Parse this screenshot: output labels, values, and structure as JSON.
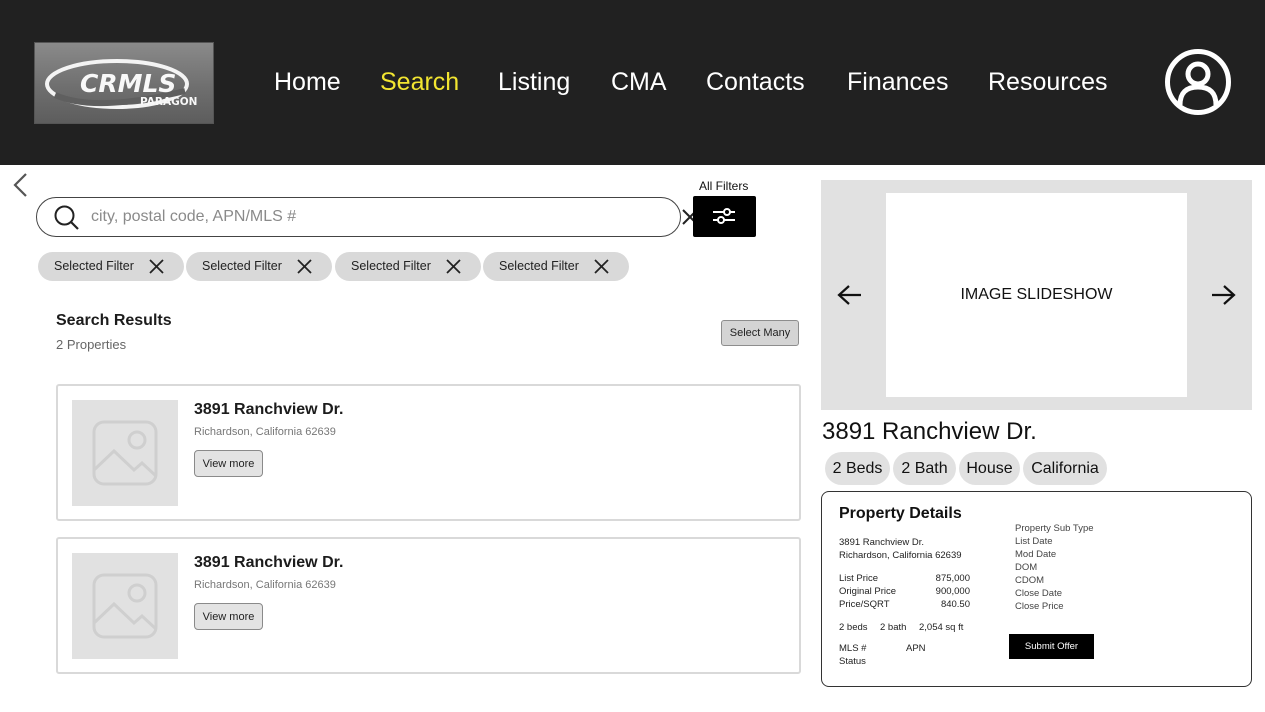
{
  "header": {
    "logo": {
      "text": "CRMLS",
      "subtext": "PARAGON"
    },
    "nav": [
      {
        "label": "Home",
        "active": false
      },
      {
        "label": "Search",
        "active": true
      },
      {
        "label": "Listing",
        "active": false
      },
      {
        "label": "CMA",
        "active": false
      },
      {
        "label": "Contacts",
        "active": false
      },
      {
        "label": "Finances",
        "active": false
      },
      {
        "label": "Resources",
        "active": false
      }
    ],
    "profile_icon": "user-circle-icon"
  },
  "search": {
    "placeholder": "city, postal code, APN/MLS #",
    "value": "",
    "all_filters_label": "All Filters"
  },
  "filters": [
    {
      "label": "Selected Filter"
    },
    {
      "label": "Selected Filter"
    },
    {
      "label": "Selected Filter"
    },
    {
      "label": "Selected Filter"
    }
  ],
  "results": {
    "title": "Search Results",
    "count": "2 Properties",
    "select_many_label": "Select Many",
    "items": [
      {
        "address": "3891 Ranchview Dr.",
        "city": "Richardson, California 62639",
        "button": "View more"
      },
      {
        "address": "3891 Ranchview Dr.",
        "city": "Richardson, California 62639",
        "button": "View more"
      }
    ]
  },
  "slideshow": {
    "label": "IMAGE SLIDESHOW"
  },
  "detail": {
    "title": "3891 Ranchview Dr.",
    "tags": [
      "2 Beds",
      "2 Bath",
      "House",
      "California"
    ],
    "card": {
      "title": "Property Details",
      "address_line1": "3891 Ranchview Dr.",
      "address_line2": "Richardson, California 62639",
      "prices": [
        {
          "label": "List Price",
          "value": "875,000"
        },
        {
          "label": "Original Price",
          "value": "900,000"
        },
        {
          "label": "Price/SQRT",
          "value": "840.50"
        }
      ],
      "beds": "2 beds",
      "baths": "2 bath",
      "sqft": "2,054 sq ft",
      "mls_label": "MLS #",
      "apn_label": "APN",
      "status_label": "Status",
      "right_fields": [
        "Property Sub Type",
        "List Date",
        "Mod Date",
        "DOM",
        "CDOM",
        "Close Date",
        "Close Price"
      ],
      "submit_label": "Submit Offer"
    }
  },
  "colors": {
    "header_bg": "#212121",
    "nav_active": "#f2e531",
    "chip_bg": "#d9d9d9"
  }
}
